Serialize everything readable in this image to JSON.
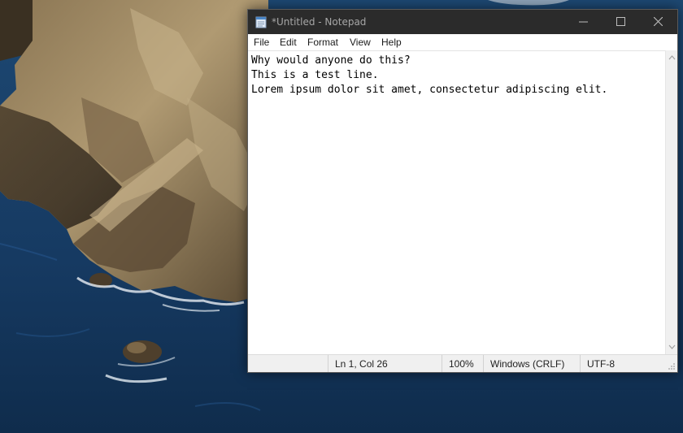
{
  "window": {
    "title": "*Untitled - Notepad"
  },
  "menu": {
    "items": [
      {
        "label": "File"
      },
      {
        "label": "Edit"
      },
      {
        "label": "Format"
      },
      {
        "label": "View"
      },
      {
        "label": "Help"
      }
    ]
  },
  "editor": {
    "lines": [
      "Why would anyone do this?",
      "This is a test line.",
      "Lorem ipsum dolor sit amet, consectetur adipiscing elit."
    ]
  },
  "status": {
    "position": "Ln 1, Col 26",
    "zoom": "100%",
    "line_endings": "Windows (CRLF)",
    "encoding": "UTF-8"
  },
  "icons": {
    "app": "notepad-icon",
    "minimize": "minimize-icon",
    "maximize": "maximize-icon",
    "close": "close-icon"
  },
  "colors": {
    "titlebar": "#2b2b2b",
    "title_text": "#a6a6a6",
    "statusbar": "#f0f0f0",
    "sea": "#15365a"
  }
}
